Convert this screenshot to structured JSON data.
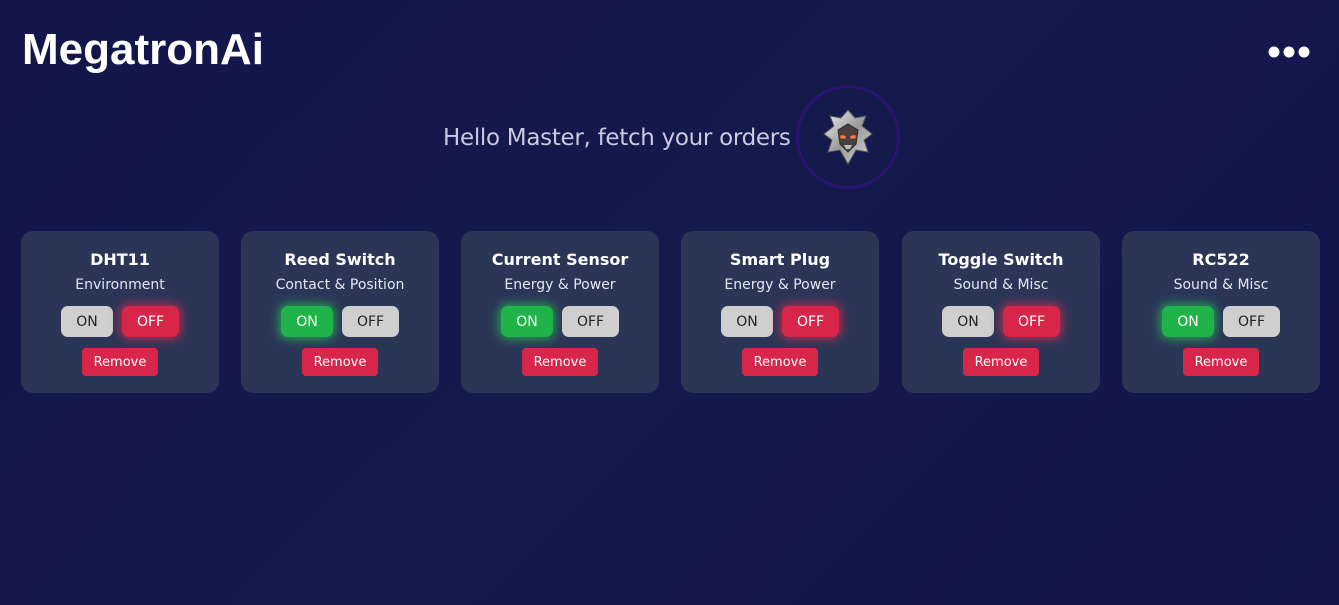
{
  "header": {
    "app_title": "MegatronAi",
    "menu_icon": "more-horizontal-icon"
  },
  "greeting": {
    "text": "Hello Master, fetch your orders",
    "avatar_icon": "robot-avatar-icon"
  },
  "colors": {
    "background": "#12164a",
    "card": "#2b3657",
    "active_on": "#1fb34a",
    "active_off": "#d8254a",
    "inactive": "#cfcfcf",
    "remove": "#d8254a"
  },
  "devices": [
    {
      "name": "DHT11",
      "category": "Environment",
      "state": "off",
      "on_label": "ON",
      "off_label": "OFF",
      "remove_label": "Remove"
    },
    {
      "name": "Reed Switch",
      "category": "Contact & Position",
      "state": "on",
      "on_label": "ON",
      "off_label": "OFF",
      "remove_label": "Remove"
    },
    {
      "name": "Current Sensor",
      "category": "Energy & Power",
      "state": "on",
      "on_label": "ON",
      "off_label": "OFF",
      "remove_label": "Remove"
    },
    {
      "name": "Smart Plug",
      "category": "Energy & Power",
      "state": "off",
      "on_label": "ON",
      "off_label": "OFF",
      "remove_label": "Remove"
    },
    {
      "name": "Toggle Switch",
      "category": "Sound & Misc",
      "state": "off",
      "on_label": "ON",
      "off_label": "OFF",
      "remove_label": "Remove"
    },
    {
      "name": "RC522",
      "category": "Sound & Misc",
      "state": "on",
      "on_label": "ON",
      "off_label": "OFF",
      "remove_label": "Remove"
    }
  ]
}
